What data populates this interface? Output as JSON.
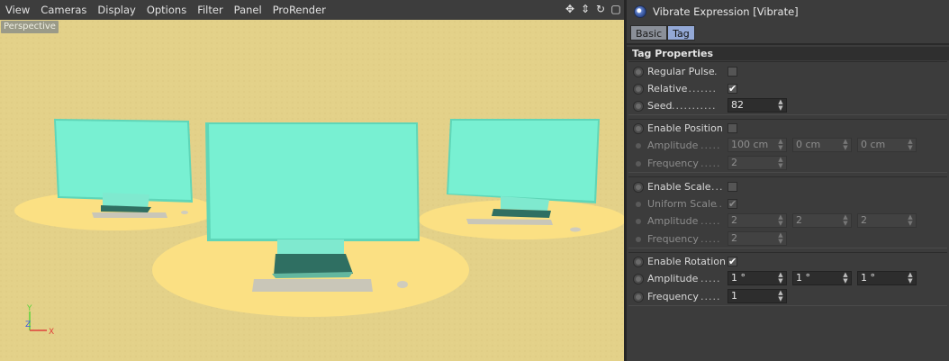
{
  "viewport": {
    "menu": [
      "View",
      "Cameras",
      "Display",
      "Options",
      "Filter",
      "Panel",
      "ProRender"
    ],
    "label": "Perspective",
    "axis": {
      "y": "Y",
      "z": "Z",
      "x": "X"
    },
    "colors": {
      "background": "#e3d189",
      "ground": "#fbe083",
      "monitor": "#78f0d2",
      "keyboard": "#c8c5b8"
    }
  },
  "toolbar_icons": [
    "move-icon",
    "zoom-icon",
    "rotate-icon",
    "maximize-icon"
  ],
  "attributes": {
    "title": "Vibrate Expression [Vibrate]",
    "tabs": [
      "Basic",
      "Tag"
    ],
    "active_tab": "Tag",
    "section": "Tag Properties",
    "regular_pulse": {
      "label": "Regular Pulse",
      "dots": ".",
      "checked": false
    },
    "relative": {
      "label": "Relative",
      "dots": "........",
      "checked": true
    },
    "seed": {
      "label": "Seed",
      "dots": "...........",
      "value": "82"
    },
    "position": {
      "enable_label": "Enable Position",
      "enabled": false,
      "amplitude_label": "Amplitude",
      "amplitude_dots": ".....",
      "amplitude": [
        "100 cm",
        "0 cm",
        "0 cm"
      ],
      "frequency_label": "Frequency",
      "frequency_dots": ".....",
      "frequency": "2"
    },
    "scale": {
      "enable_label": "Enable Scale",
      "enable_dots": "...",
      "enabled": false,
      "uniform_label": "Uniform Scale",
      "uniform_dots": "..",
      "uniform": true,
      "amplitude_label": "Amplitude",
      "amplitude_dots": ".....",
      "amplitude": [
        "2",
        "2",
        "2"
      ],
      "frequency_label": "Frequency",
      "frequency_dots": ".....",
      "frequency": "2"
    },
    "rotation": {
      "enable_label": "Enable Rotation",
      "enabled": true,
      "amplitude_label": "Amplitude",
      "amplitude_dots": ".....",
      "amplitude": [
        "1 °",
        "1 °",
        "1 °"
      ],
      "frequency_label": "Frequency",
      "frequency_dots": ".....",
      "frequency": "1"
    }
  }
}
